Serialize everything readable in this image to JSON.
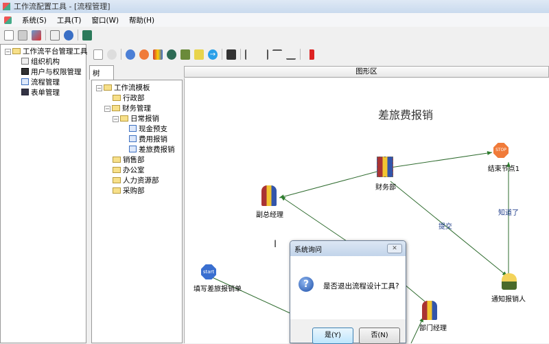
{
  "window": {
    "title": "工作流配置工具 - [流程管理]"
  },
  "menu": [
    "系统(S)",
    "工具(T)",
    "窗口(W)",
    "帮助(H)"
  ],
  "left_tree": {
    "root": "工作流平台管理工具",
    "items": [
      "组织机构",
      "用户与权限管理",
      "流程管理",
      "表单管理"
    ]
  },
  "tab_tree": "树",
  "area_header": "图形区",
  "template_tree": {
    "root": "工作流模板",
    "admin": "行政部",
    "finance": "财务管理",
    "daily": "日常报销",
    "flows": [
      "现金预支",
      "费用报销",
      "差旅费报销"
    ],
    "others": [
      "销售部",
      "办公室",
      "人力资源部",
      "采购部"
    ]
  },
  "diagram": {
    "title": "差旅费报销",
    "nodes": {
      "finance": "财务部",
      "end": "结束节点1",
      "vp": "副总经理",
      "notify": "通知报销人",
      "dept": "部门经理",
      "start": "填写差旅报销单"
    },
    "start_badge": "start",
    "stop_badge": "STOP",
    "edges": {
      "submit": "提交",
      "known": "知道了"
    }
  },
  "dialog": {
    "title": "系统询问",
    "close": "✕",
    "message": "是否退出流程设计工具?",
    "yes": "是(Y)",
    "no": "否(N)"
  }
}
